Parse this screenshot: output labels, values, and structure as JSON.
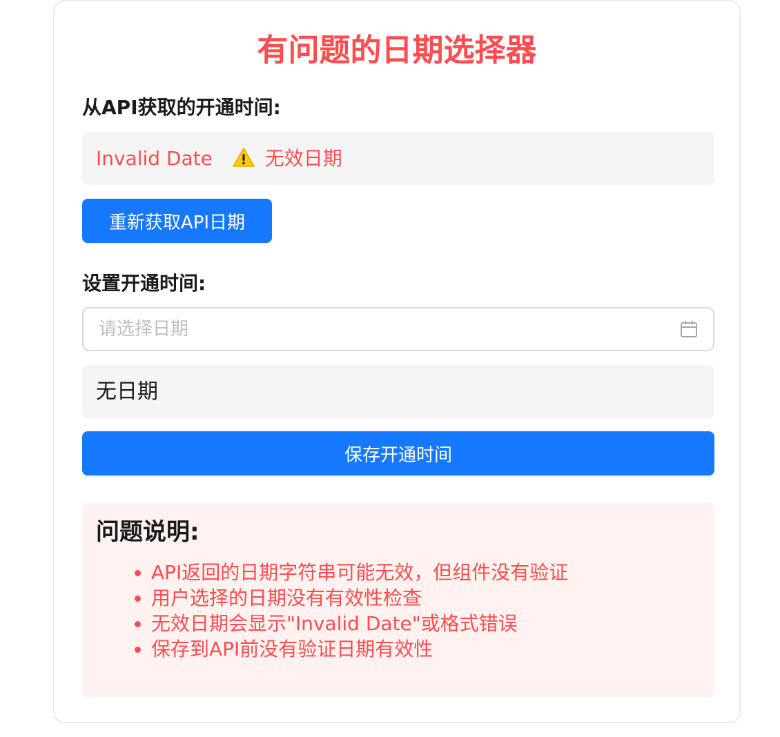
{
  "title": "有问题的日期选择器",
  "api_section": {
    "label": "从API获取的开通时间:",
    "value": "Invalid Date",
    "warning_text": "无效日期",
    "warning_icon": "warning-triangle-icon",
    "refetch_button": "重新获取API日期"
  },
  "set_section": {
    "label": "设置开通时间:",
    "date_input": {
      "value": "",
      "placeholder": "请选择日期",
      "icon": "calendar-icon"
    },
    "display_value": "无日期",
    "save_button": "保存开通时间"
  },
  "problem": {
    "title": "问题说明:",
    "items": [
      "API返回的日期字符串可能无效，但组件没有验证",
      "用户选择的日期没有有效性检查",
      "无效日期会显示\"Invalid Date\"或格式错误",
      "保存到API前没有验证日期有效性"
    ]
  },
  "colors": {
    "accent": "#1677ff",
    "error": "#ff4d4f",
    "problem_bg": "#fff2f0",
    "box_bg": "#f5f5f5"
  }
}
